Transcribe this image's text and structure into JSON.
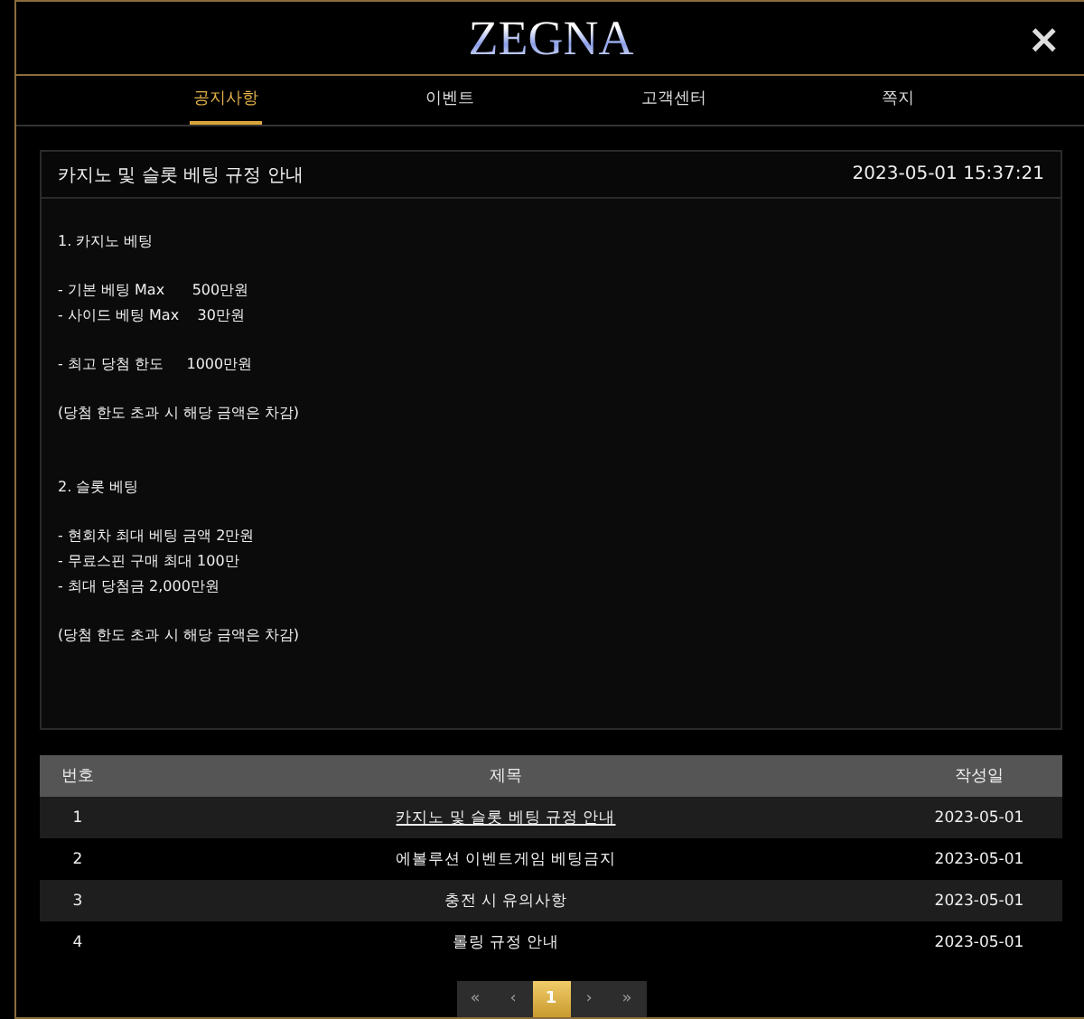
{
  "header": {
    "logo": "ZEGNA",
    "close": "×"
  },
  "tabs": [
    {
      "label": "공지사항",
      "selected": true
    },
    {
      "label": "이벤트",
      "selected": false
    },
    {
      "label": "고객센터",
      "selected": false
    },
    {
      "label": "쪽지",
      "selected": false
    }
  ],
  "notice": {
    "title": "카지노 및 슬롯 베팅 규정 안내",
    "date": "2023-05-01 15:37:21",
    "sections": [
      {
        "paragraphs": [
          [
            "1. 카지노 베팅"
          ],
          [
            "- 기본 베팅 Max      500만원",
            "- 사이드 베팅 Max    30만원"
          ],
          [
            "- 최고 당첨 한도     1000만원"
          ],
          [
            "(당첨 한도 초과 시 해당 금액은 차감)"
          ]
        ]
      },
      {
        "paragraphs": [
          [
            "2. 슬롯 베팅"
          ],
          [
            "- 현회차 최대 베팅 금액 2만원",
            "- 무료스핀 구매 최대 100만",
            "- 최대 당첨금 2,000만원"
          ],
          [
            "(당첨 한도 초과 시 해당 금액은 차감)"
          ]
        ]
      }
    ]
  },
  "table": {
    "columns": [
      "번호",
      "제목",
      "작성일"
    ],
    "rows": [
      {
        "number": "1",
        "title": "카지노 및 슬롯 베팅 규정 안내",
        "date": "2023-05-01",
        "selected": true
      },
      {
        "number": "2",
        "title": "에볼루션 이벤트게임 베팅금지",
        "date": "2023-05-01",
        "selected": false
      },
      {
        "number": "3",
        "title": "충전 시 유의사항",
        "date": "2023-05-01",
        "selected": false
      },
      {
        "number": "4",
        "title": "롤링 규정 안내",
        "date": "2023-05-01",
        "selected": false
      }
    ]
  },
  "pagination": [
    {
      "label": "«",
      "selected": false
    },
    {
      "label": "‹",
      "selected": false
    },
    {
      "label": "1",
      "selected": true
    },
    {
      "label": "›",
      "selected": false
    },
    {
      "label": "»",
      "selected": false
    }
  ]
}
